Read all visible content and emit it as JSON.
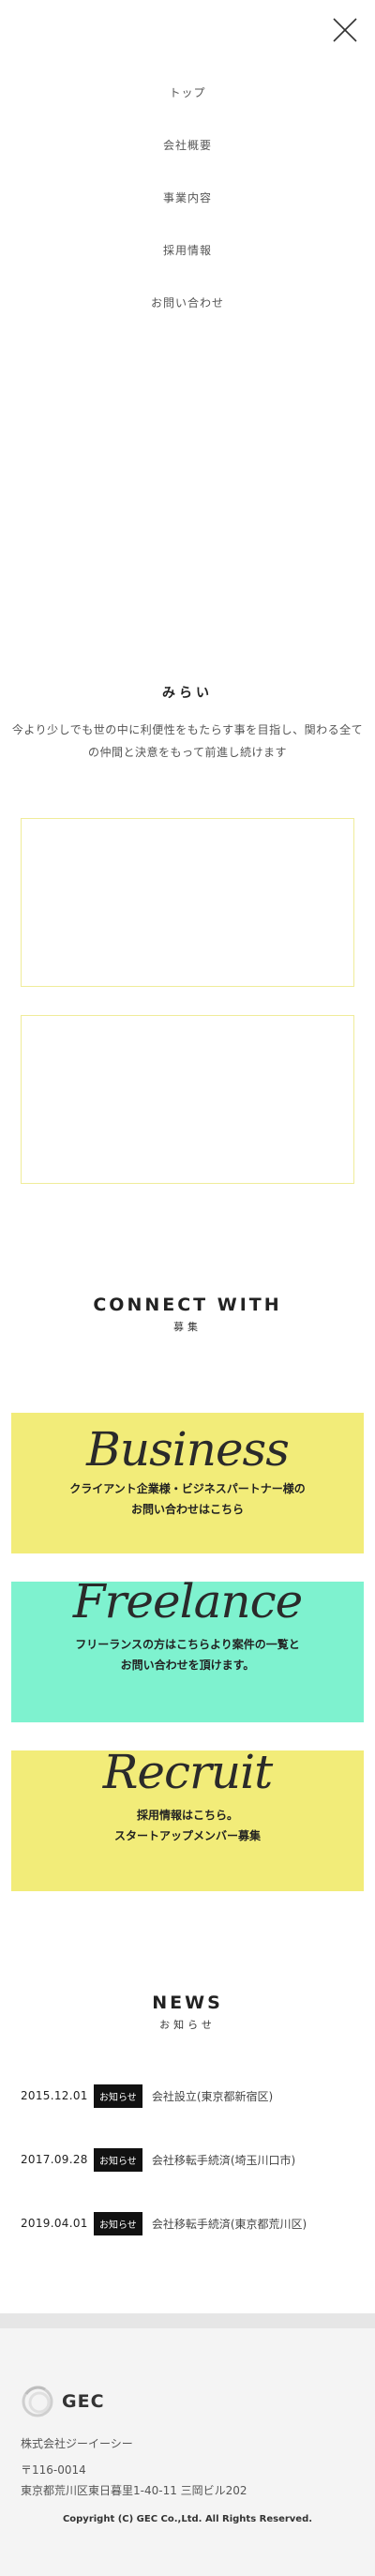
{
  "nav": {
    "items": [
      {
        "label": "トップ"
      },
      {
        "label": "会社概要"
      },
      {
        "label": "事業内容"
      },
      {
        "label": "採用情報"
      },
      {
        "label": "お問い合わせ"
      }
    ]
  },
  "mission": {
    "title": "みらい",
    "text": "今より少しでも世の中に利便性をもたらす事を目指し、関わる全ての仲間と決意をもって前進し続けます"
  },
  "connect": {
    "title": "CONNECT WITH",
    "subtitle": "募集",
    "cards": [
      {
        "title": "Business",
        "line1": "クライアント企業様・ビジネスパートナー様の",
        "line2": "お問い合わせはこちら",
        "color": "#f2ec79"
      },
      {
        "title": "Freelance",
        "line1": "フリーランスの方はこちらより案件の一覧と",
        "line2": "お問い合わせを頂けます。",
        "color": "#7ef2cf"
      },
      {
        "title": "Recruit",
        "line1": "採用情報はこちら。",
        "line2": "スタートアップメンバー募集",
        "color": "#f2ec79"
      }
    ]
  },
  "news": {
    "title": "NEWS",
    "subtitle": "お知らせ",
    "badge": "お知らせ",
    "items": [
      {
        "date": "2015.12.01",
        "title": "会社設立(東京都新宿区)"
      },
      {
        "date": "2017.09.28",
        "title": "会社移転手続済(埼玉川口市)"
      },
      {
        "date": "2019.04.01",
        "title": "会社移転手続済(東京都荒川区)"
      }
    ]
  },
  "footer": {
    "logo_text": "GEC",
    "company": "株式会社ジーイーシー",
    "postal": "〒116-0014",
    "address": "東京都荒川区東日暮里1-40-11 三岡ビル202",
    "copyright": "Copyright (C) GEC Co.,Ltd. All Rights Reserved."
  },
  "icons": {
    "close": "close-icon",
    "logo": "gec-logo-icon"
  }
}
